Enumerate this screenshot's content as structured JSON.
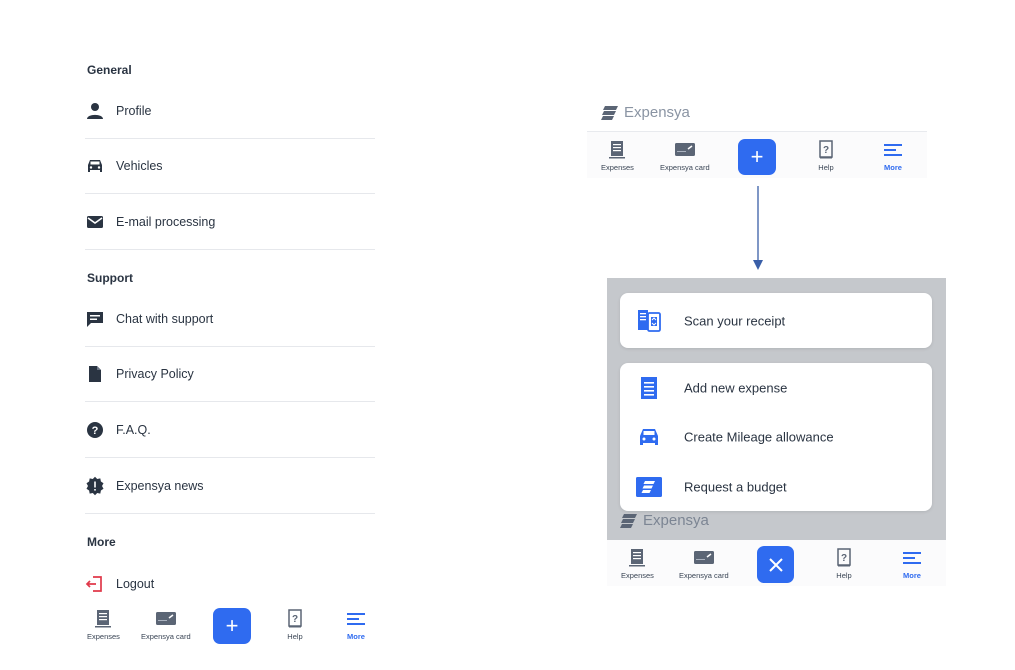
{
  "settings": {
    "sections": [
      {
        "title": "General"
      },
      {
        "title": "Support"
      },
      {
        "title": "More"
      }
    ],
    "items": {
      "profile": "Profile",
      "vehicles": "Vehicles",
      "email": "E-mail processing",
      "chat": "Chat with support",
      "privacy": "Privacy Policy",
      "faq": "F.A.Q.",
      "news": "Expensya news",
      "logout": "Logout"
    }
  },
  "tabbar": {
    "expenses": "Expenses",
    "card": "Expensya card",
    "help": "Help",
    "more": "More"
  },
  "brand": "Expensya",
  "actions": {
    "scan": "Scan your receipt",
    "add": "Add new expense",
    "mileage": "Create Mileage allowance",
    "budget": "Request a budget"
  },
  "colors": {
    "accent": "#2f6bf0",
    "text": "#2a3442",
    "overlay": "#c5c8cc",
    "logout": "#e0394a"
  }
}
